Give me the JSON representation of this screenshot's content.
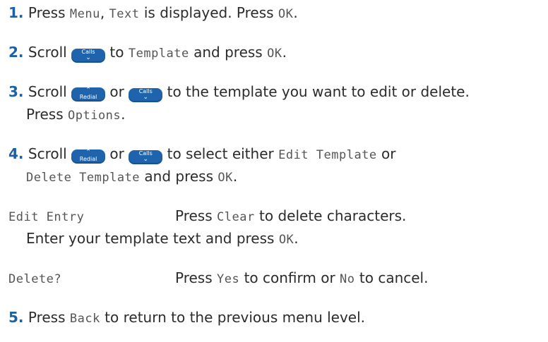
{
  "steps": [
    {
      "num": "1.",
      "t1": "Press ",
      "lcd1": "Menu",
      "t2": ", ",
      "lcd2": "Text",
      "t3": " is displayed. Press ",
      "lcd3": "OK",
      "t4": "."
    },
    {
      "num": "2.",
      "t1": "Scroll ",
      "t2": " to ",
      "lcd1": "Template",
      "t3": " and press ",
      "lcd2": "OK",
      "t4": "."
    },
    {
      "num": "3.",
      "t1": "Scroll ",
      "t2": " or ",
      "t3": " to the template you want to edit or delete.",
      "cont_t1": "Press ",
      "cont_lcd1": "Options",
      "cont_t2": "."
    },
    {
      "num": "4.",
      "t1": "Scroll ",
      "t2": " or ",
      "t3": " to select either ",
      "lcd1": "Edit Template",
      "t4": " or",
      "cont_lcd1": "Delete Template",
      "cont_t1": " and press ",
      "cont_lcd2": "OK",
      "cont_t2": "."
    },
    {
      "num": "5.",
      "t1": "Press ",
      "lcd1": "Back",
      "t2": " to return to the previous menu level."
    }
  ],
  "screens": [
    {
      "lcd": "Edit Entry",
      "t1": "Press ",
      "lcd2": "Clear",
      "t2": " to delete characters.",
      "cont_t1": "Enter your template text and press ",
      "cont_lcd1": "OK",
      "cont_t2": "."
    },
    {
      "lcd": "Delete?",
      "t1": "Press ",
      "lcd2": "Yes",
      "t2": " to confirm or ",
      "lcd3": "No",
      "t3": " to cancel."
    }
  ],
  "keys": {
    "calls": {
      "label": "Calls",
      "icon": "chevron-down-icon"
    },
    "redial": {
      "label": "Redial",
      "icon": "chevron-up-icon"
    }
  },
  "colors": {
    "step_number": "#1f5fa6",
    "key": "#1f63ad",
    "lcd_text": "#555555",
    "body_text": "#2b2b2b"
  }
}
